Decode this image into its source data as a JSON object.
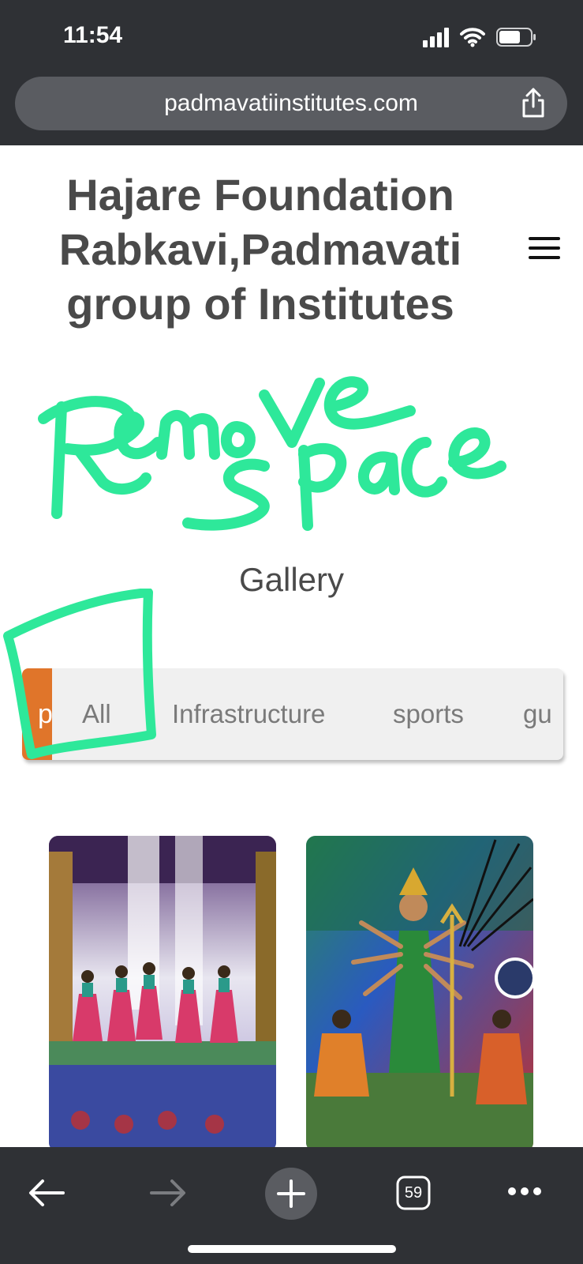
{
  "status_bar": {
    "time": "11:54"
  },
  "browser": {
    "url": "padmavatiinstitutes.com",
    "tabs_count": "59"
  },
  "site": {
    "title": "Hajare Foundation Rabkavi,Padmavati group of Institutes"
  },
  "annotation": {
    "handwritten_text": "Remove Space",
    "color": "#2ee89a"
  },
  "gallery": {
    "heading": "Gallery",
    "filters": [
      {
        "label": "p",
        "active": true
      },
      {
        "label": "All"
      },
      {
        "label": "Infrastructure"
      },
      {
        "label": "sports"
      },
      {
        "label": "gu"
      }
    ],
    "images": [
      {
        "subject": "dancers-on-stage"
      },
      {
        "subject": "durga-performance"
      }
    ]
  },
  "colors": {
    "browser_chrome": "#2f3135",
    "active_filter": "#e0752a",
    "title_text": "#4a4a4a"
  },
  "toolbar": {
    "back_icon": "arrow-left-icon",
    "forward_icon": "arrow-right-icon",
    "new_tab_icon": "plus-icon",
    "tabs_icon": "tabs-icon",
    "more_icon": "more-icon"
  }
}
